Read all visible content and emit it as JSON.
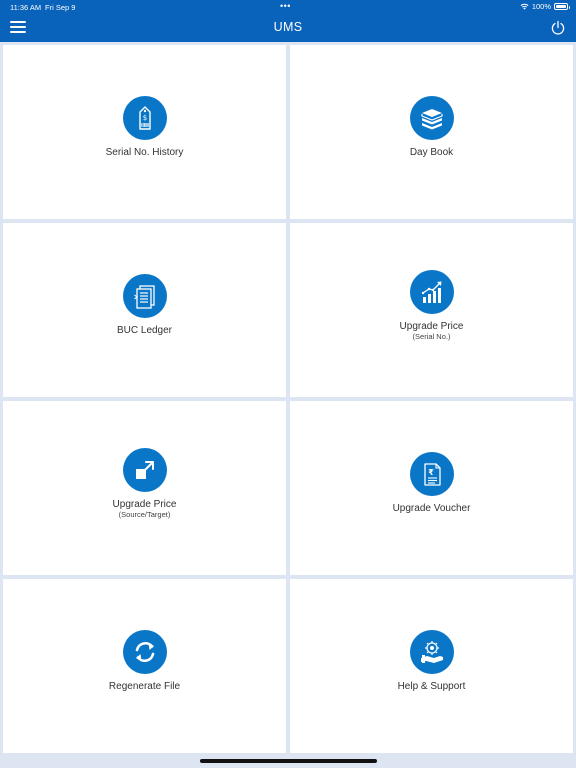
{
  "status_bar": {
    "time": "11:36 AM",
    "date": "Fri Sep 9",
    "dots": "•••",
    "battery": "100%"
  },
  "nav": {
    "title": "UMS",
    "menu_icon": "hamburger-menu-icon",
    "power_icon": "power-icon"
  },
  "colors": {
    "brand": "#0a63bb",
    "icon_circle": "#0a76c8",
    "background": "#dde4f2"
  },
  "tiles": [
    {
      "label": "Serial No. History",
      "sublabel": "",
      "icon": "price-tag-barcode-icon"
    },
    {
      "label": "Day Book",
      "sublabel": "",
      "icon": "book-stack-icon"
    },
    {
      "label": "BUC Ledger",
      "sublabel": "",
      "icon": "ledger-document-icon"
    },
    {
      "label": "Upgrade Price",
      "sublabel": "(Serial No.)",
      "icon": "growth-chart-icon"
    },
    {
      "label": "Upgrade Price",
      "sublabel": "(Source/Target)",
      "icon": "upgrade-arrow-icon"
    },
    {
      "label": "Upgrade Voucher",
      "sublabel": "",
      "icon": "rupee-voucher-icon"
    },
    {
      "label": "Regenerate File",
      "sublabel": "",
      "icon": "refresh-icon"
    },
    {
      "label": "Help & Support",
      "sublabel": "",
      "icon": "support-agent-icon"
    }
  ]
}
